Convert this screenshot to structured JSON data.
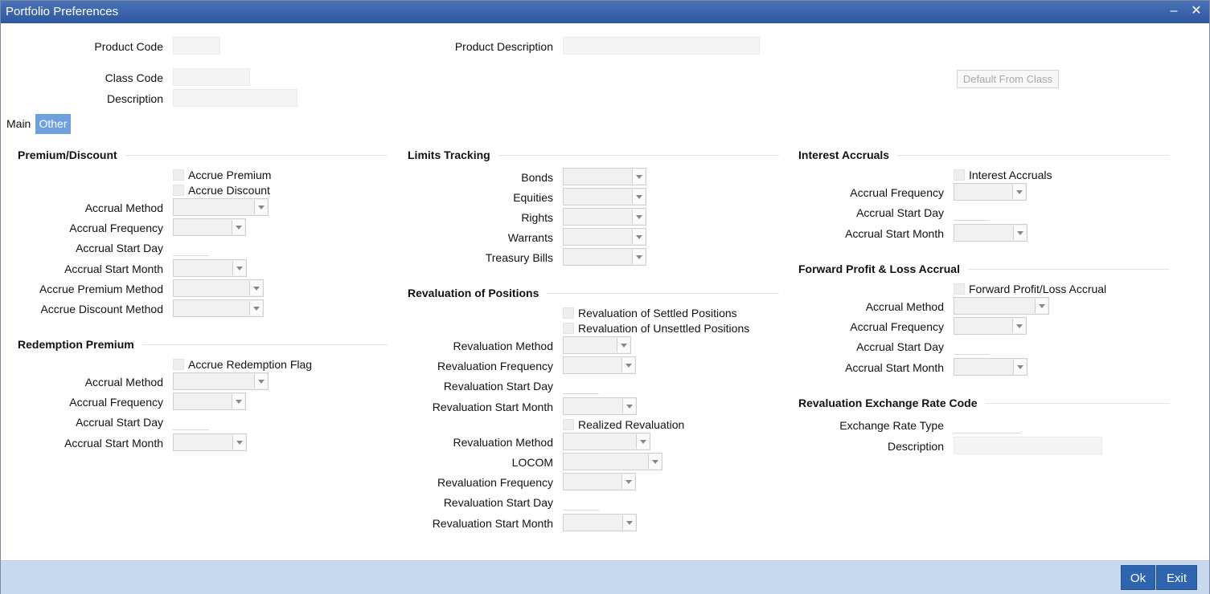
{
  "window": {
    "title": "Portfolio Preferences",
    "minimize_label": "–",
    "close_label": "✕"
  },
  "header": {
    "product_code_label": "Product Code",
    "product_code_value": "",
    "product_description_label": "Product Description",
    "product_description_value": "",
    "class_code_label": "Class Code",
    "class_code_value": "",
    "description_label": "Description",
    "description_value": "",
    "default_from_class_label": "Default From Class"
  },
  "tabs": {
    "main_label": "Main",
    "other_label": "Other",
    "active": "Other"
  },
  "premium_discount": {
    "title": "Premium/Discount",
    "accrue_premium_label": "Accrue Premium",
    "accrue_discount_label": "Accrue Discount",
    "accrual_method_label": "Accrual Method",
    "accrual_frequency_label": "Accrual Frequency",
    "accrual_start_day_label": "Accrual Start Day",
    "accrual_start_month_label": "Accrual Start Month",
    "accrue_premium_method_label": "Accrue Premium Method",
    "accrue_discount_method_label": "Accrue Discount Method"
  },
  "redemption_premium": {
    "title": "Redemption Premium",
    "accrue_redemption_flag_label": "Accrue Redemption Flag",
    "accrual_method_label": "Accrual Method",
    "accrual_frequency_label": "Accrual Frequency",
    "accrual_start_day_label": "Accrual Start Day",
    "accrual_start_month_label": "Accrual Start Month"
  },
  "limits_tracking": {
    "title": "Limits Tracking",
    "bonds_label": "Bonds",
    "equities_label": "Equities",
    "rights_label": "Rights",
    "warrants_label": "Warrants",
    "treasury_bills_label": "Treasury Bills"
  },
  "revaluation_positions": {
    "title": "Revaluation of Positions",
    "settled_label": "Revaluation of Settled Positions",
    "unsettled_label": "Revaluation of Unsettled Positions",
    "revaluation_method_label": "Revaluation Method",
    "revaluation_frequency_label": "Revaluation Frequency",
    "revaluation_start_day_label": "Revaluation Start Day",
    "revaluation_start_month_label": "Revaluation Start Month",
    "realized_revaluation_label": "Realized Revaluation",
    "realized_method_label": "Revaluation Method",
    "locom_label": "LOCOM",
    "realized_frequency_label": "Revaluation Frequency",
    "realized_start_day_label": "Revaluation Start Day",
    "realized_start_month_label": "Revaluation Start Month"
  },
  "interest_accruals": {
    "title": "Interest Accruals",
    "interest_accruals_label": "Interest Accruals",
    "accrual_frequency_label": "Accrual Frequency",
    "accrual_start_day_label": "Accrual Start Day",
    "accrual_start_month_label": "Accrual Start Month"
  },
  "forward_pl": {
    "title": "Forward Profit & Loss Accrual",
    "forward_pl_label": "Forward Profit/Loss Accrual",
    "accrual_method_label": "Accrual Method",
    "accrual_frequency_label": "Accrual Frequency",
    "accrual_start_day_label": "Accrual Start Day",
    "accrual_start_month_label": "Accrual Start Month"
  },
  "revaluation_exchange": {
    "title": "Revaluation Exchange Rate Code",
    "exchange_rate_type_label": "Exchange Rate Type",
    "description_label": "Description"
  },
  "footer": {
    "ok_label": "Ok",
    "exit_label": "Exit"
  },
  "colors": {
    "title_bar": "#2d57a3",
    "active_tab": "#6fa0dd",
    "footer": "#c6d9ee",
    "footer_button": "#2f64ae"
  }
}
